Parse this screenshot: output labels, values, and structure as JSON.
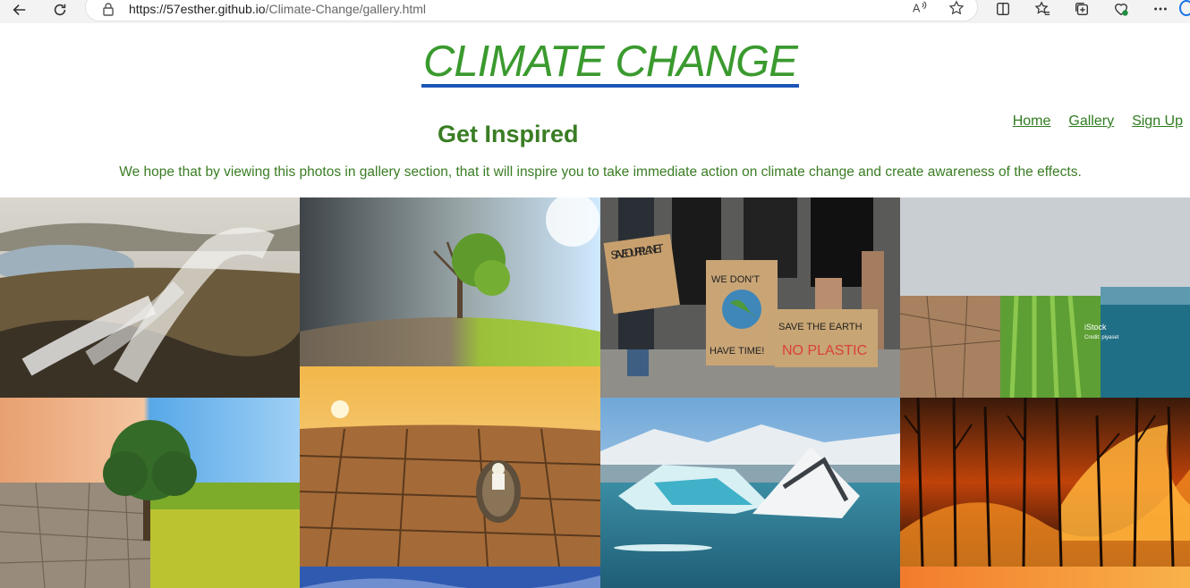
{
  "browser": {
    "url_domain": "https://57esther.github.io",
    "url_path": "/Climate-Change/gallery.html",
    "icons": [
      "back-arrow-icon",
      "refresh-icon",
      "lock-icon",
      "read-aloud-icon",
      "favorite-star-icon",
      "split-screen-icon",
      "favorites-icon",
      "collections-icon",
      "browser-essentials-icon",
      "more-icon"
    ]
  },
  "site": {
    "title": "CLIMATE CHANGE"
  },
  "nav": {
    "home": "Home",
    "gallery": "Gallery",
    "signup": "Sign Up"
  },
  "section": {
    "heading": "Get Inspired",
    "intro": "We hope that by viewing this photos in gallery section, that it will inspire you to take immediate action on climate change and create awareness of the effects."
  },
  "gallery": {
    "protest_signs": {
      "save_our_planet": "SAVE OUR PLANET",
      "we_dont_have_time_1": "WE DON'T",
      "we_dont_have_time_2": "HAVE TIME!",
      "save_the_earth": "SAVE THE EARTH",
      "no_plastic": "NO PLASTIC"
    },
    "watermark_brand": "iStock",
    "watermark_credit": "Credit: piyaset"
  }
}
